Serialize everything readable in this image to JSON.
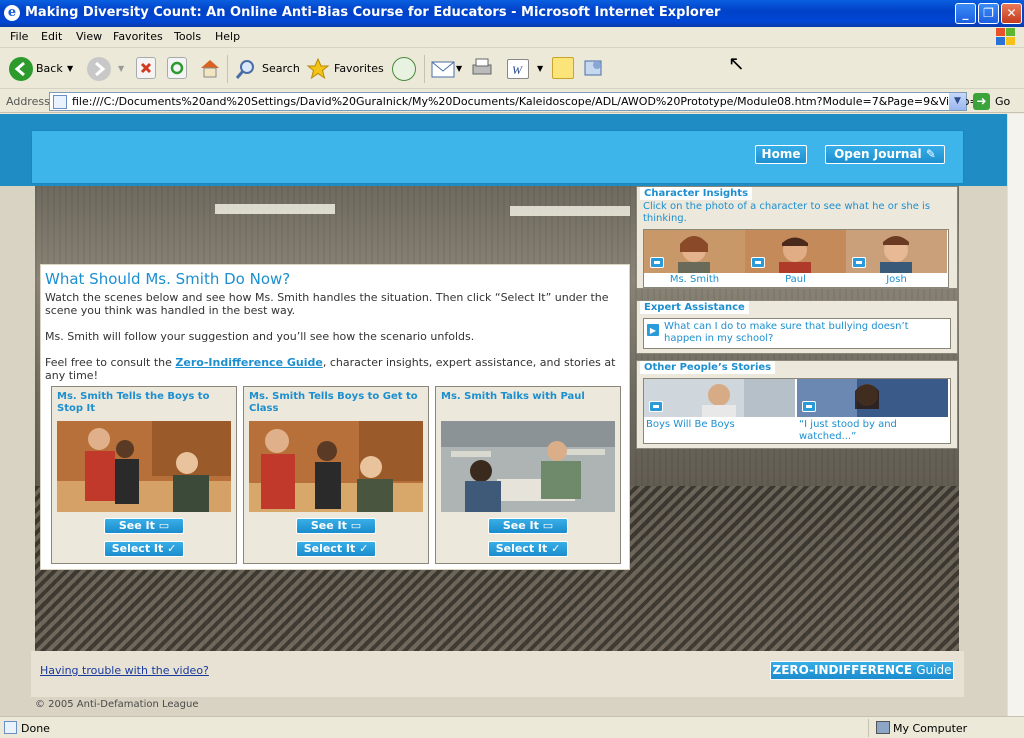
{
  "window": {
    "title": "Making Diversity Count: An Online Anti-Bias Course for Educators - Microsoft Internet Explorer",
    "minimize_glyph": "_",
    "maximize_glyph": "❐",
    "close_glyph": "✕"
  },
  "menu": [
    "File",
    "Edit",
    "View",
    "Favorites",
    "Tools",
    "Help"
  ],
  "toolbar": {
    "back": "Back",
    "search": "Search",
    "favorites": "Favorites"
  },
  "address": {
    "label": "Address",
    "url": "file:///C:/Documents%20and%20Settings/David%20Guralnick/My%20Documents/Kaleidoscope/ADL/AWOD%20Prototype/Module08.htm?Module=7&Page=9&Video=0",
    "go": "Go"
  },
  "header": {
    "home": "Home",
    "open_journal": "Open Journal ✎"
  },
  "main": {
    "title": "What Should Ms. Smith Do Now?",
    "intro": "Watch the scenes below and see how Ms. Smith handles the situation. Then click “Select It” under the scene you think was handled in the best way.",
    "follow": "Ms. Smith will follow your suggestion and you’ll see how the scenario unfolds.",
    "consult_pre": "Feel free to consult the ",
    "consult_link": "Zero-Indifference Guide",
    "consult_post": ", character insights, expert assistance, and stories at any time!",
    "choices": [
      {
        "title": "Ms. Smith Tells the Boys to Stop It",
        "see_it": "See It ▭",
        "select_it": "Select It ✓"
      },
      {
        "title": "Ms. Smith Tells Boys to Get to Class",
        "see_it": "See It ▭",
        "select_it": "Select It ✓"
      },
      {
        "title": "Ms. Smith Talks with Paul",
        "see_it": "See It ▭",
        "select_it": "Select It ✓"
      }
    ]
  },
  "sidebar": {
    "character_insights": {
      "heading": "Character Insights",
      "desc": "Click on the photo of a character to see what he or she is thinking.",
      "characters": [
        "Ms. Smith",
        "Paul",
        "Josh"
      ]
    },
    "expert_assistance": {
      "heading": "Expert Assistance",
      "question": "What can I do to make sure that bullying doesn’t happen in my school?"
    },
    "stories": {
      "heading": "Other People’s Stories",
      "items": [
        "Boys Will Be Boys",
        "“I just stood by and watched...”"
      ]
    }
  },
  "footer": {
    "help": "Having trouble with the video?",
    "zi_guide_main": "ZERO-INDIFFERENCE ",
    "zi_guide_sub": "Guide",
    "copyright": "© 2005 Anti-Defamation League"
  },
  "status": {
    "left": "Done",
    "right": "My Computer"
  },
  "colors": {
    "accent": "#1d8fcf",
    "header": "#3db5eb",
    "xp_blue": "#0046d5"
  }
}
